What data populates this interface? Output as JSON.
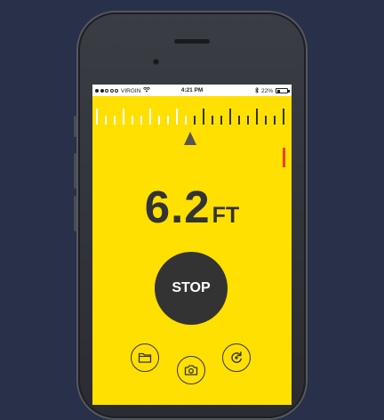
{
  "status_bar": {
    "carrier": "VIRGIN",
    "time": "4:21 PM",
    "battery_percent": "22%",
    "signal_bars_filled": 2,
    "battery_level": 0.22
  },
  "measurement": {
    "value": "6.2",
    "unit": "FT"
  },
  "controls": {
    "stop_label": "STOP"
  },
  "icons": {
    "files": "folder-icon",
    "camera": "camera-icon",
    "reset": "refresh-icon"
  },
  "colors": {
    "background": "#28304a",
    "screen": "#ffe000",
    "ink": "#333333",
    "button_text": "#ffffff",
    "marker": "#e8401c"
  }
}
